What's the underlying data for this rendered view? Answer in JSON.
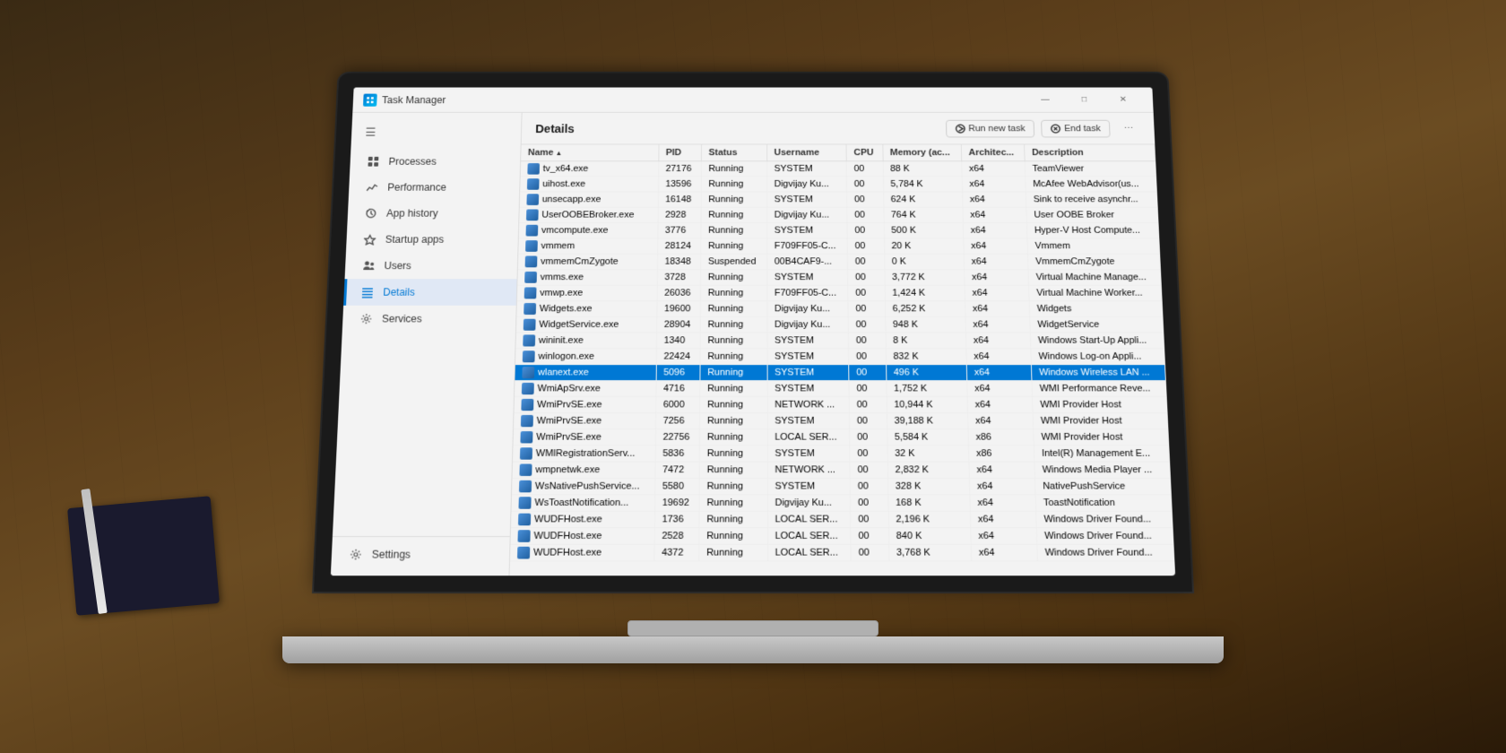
{
  "app": {
    "title": "Task Manager",
    "controls": {
      "minimize": "—",
      "maximize": "□",
      "close": "✕"
    }
  },
  "sidebar": {
    "hamburger": "☰",
    "items": [
      {
        "id": "processes",
        "label": "Processes",
        "icon": "grid"
      },
      {
        "id": "performance",
        "label": "Performance",
        "icon": "chart"
      },
      {
        "id": "app-history",
        "label": "App history",
        "icon": "clock"
      },
      {
        "id": "startup-apps",
        "label": "Startup apps",
        "icon": "rocket"
      },
      {
        "id": "users",
        "label": "Users",
        "icon": "people"
      },
      {
        "id": "details",
        "label": "Details",
        "icon": "list",
        "active": true
      },
      {
        "id": "services",
        "label": "Services",
        "icon": "gear-sm"
      }
    ],
    "settings": {
      "label": "Settings",
      "icon": "gear"
    }
  },
  "content": {
    "title": "Details",
    "actions": {
      "run_new_task": "Run new task",
      "end_task": "End task",
      "more": "⋯"
    }
  },
  "table": {
    "columns": [
      {
        "id": "name",
        "label": "Name",
        "sorted": true
      },
      {
        "id": "pid",
        "label": "PID"
      },
      {
        "id": "status",
        "label": "Status"
      },
      {
        "id": "username",
        "label": "Username"
      },
      {
        "id": "cpu",
        "label": "CPU"
      },
      {
        "id": "memory",
        "label": "Memory (ac..."
      },
      {
        "id": "architecture",
        "label": "Architec..."
      },
      {
        "id": "description",
        "label": "Description"
      }
    ],
    "rows": [
      {
        "name": "tv_x64.exe",
        "pid": "27176",
        "status": "Running",
        "username": "SYSTEM",
        "cpu": "00",
        "memory": "88 K",
        "arch": "x64",
        "desc": "TeamViewer"
      },
      {
        "name": "uihost.exe",
        "pid": "13596",
        "status": "Running",
        "username": "Digvijay Ku...",
        "cpu": "00",
        "memory": "5,784 K",
        "arch": "x64",
        "desc": "McAfee WebAdvisor(us..."
      },
      {
        "name": "unsecapp.exe",
        "pid": "16148",
        "status": "Running",
        "username": "SYSTEM",
        "cpu": "00",
        "memory": "624 K",
        "arch": "x64",
        "desc": "Sink to receive asynchr..."
      },
      {
        "name": "UserOOBEBroker.exe",
        "pid": "2928",
        "status": "Running",
        "username": "Digvijay Ku...",
        "cpu": "00",
        "memory": "764 K",
        "arch": "x64",
        "desc": "User OOBE Broker"
      },
      {
        "name": "vmcompute.exe",
        "pid": "3776",
        "status": "Running",
        "username": "SYSTEM",
        "cpu": "00",
        "memory": "500 K",
        "arch": "x64",
        "desc": "Hyper-V Host Compute..."
      },
      {
        "name": "vmmem",
        "pid": "28124",
        "status": "Running",
        "username": "F709FF05-C...",
        "cpu": "00",
        "memory": "20 K",
        "arch": "x64",
        "desc": "Vmmem"
      },
      {
        "name": "vmmemCmZygote",
        "pid": "18348",
        "status": "Suspended",
        "username": "00B4CAF9-...",
        "cpu": "00",
        "memory": "0 K",
        "arch": "x64",
        "desc": "VmmemCmZygote"
      },
      {
        "name": "vmms.exe",
        "pid": "3728",
        "status": "Running",
        "username": "SYSTEM",
        "cpu": "00",
        "memory": "3,772 K",
        "arch": "x64",
        "desc": "Virtual Machine Manage..."
      },
      {
        "name": "vmwp.exe",
        "pid": "26036",
        "status": "Running",
        "username": "F709FF05-C...",
        "cpu": "00",
        "memory": "1,424 K",
        "arch": "x64",
        "desc": "Virtual Machine Worker..."
      },
      {
        "name": "Widgets.exe",
        "pid": "19600",
        "status": "Running",
        "username": "Digvijay Ku...",
        "cpu": "00",
        "memory": "6,252 K",
        "arch": "x64",
        "desc": "Widgets"
      },
      {
        "name": "WidgetService.exe",
        "pid": "28904",
        "status": "Running",
        "username": "Digvijay Ku...",
        "cpu": "00",
        "memory": "948 K",
        "arch": "x64",
        "desc": "WidgetService"
      },
      {
        "name": "wininit.exe",
        "pid": "1340",
        "status": "Running",
        "username": "SYSTEM",
        "cpu": "00",
        "memory": "8 K",
        "arch": "x64",
        "desc": "Windows Start-Up Appli..."
      },
      {
        "name": "winlogon.exe",
        "pid": "22424",
        "status": "Running",
        "username": "SYSTEM",
        "cpu": "00",
        "memory": "832 K",
        "arch": "x64",
        "desc": "Windows Log-on Appli..."
      },
      {
        "name": "wlanext.exe",
        "pid": "5096",
        "status": "Running",
        "username": "SYSTEM",
        "cpu": "00",
        "memory": "496 K",
        "arch": "x64",
        "desc": "Windows Wireless LAN ...",
        "selected": true
      },
      {
        "name": "WmiApSrv.exe",
        "pid": "4716",
        "status": "Running",
        "username": "SYSTEM",
        "cpu": "00",
        "memory": "1,752 K",
        "arch": "x64",
        "desc": "WMI Performance Reve..."
      },
      {
        "name": "WmiPrvSE.exe",
        "pid": "6000",
        "status": "Running",
        "username": "NETWORK ...",
        "cpu": "00",
        "memory": "10,944 K",
        "arch": "x64",
        "desc": "WMI Provider Host"
      },
      {
        "name": "WmiPrvSE.exe",
        "pid": "7256",
        "status": "Running",
        "username": "SYSTEM",
        "cpu": "00",
        "memory": "39,188 K",
        "arch": "x64",
        "desc": "WMI Provider Host"
      },
      {
        "name": "WmiPrvSE.exe",
        "pid": "22756",
        "status": "Running",
        "username": "LOCAL SER...",
        "cpu": "00",
        "memory": "5,584 K",
        "arch": "x86",
        "desc": "WMI Provider Host"
      },
      {
        "name": "WMIRegistrationServ...",
        "pid": "5836",
        "status": "Running",
        "username": "SYSTEM",
        "cpu": "00",
        "memory": "32 K",
        "arch": "x86",
        "desc": "Intel(R) Management E..."
      },
      {
        "name": "wmpnetwk.exe",
        "pid": "7472",
        "status": "Running",
        "username": "NETWORK ...",
        "cpu": "00",
        "memory": "2,832 K",
        "arch": "x64",
        "desc": "Windows Media Player ..."
      },
      {
        "name": "WsNativePushService...",
        "pid": "5580",
        "status": "Running",
        "username": "SYSTEM",
        "cpu": "00",
        "memory": "328 K",
        "arch": "x64",
        "desc": "NativePushService"
      },
      {
        "name": "WsToastNotification...",
        "pid": "19692",
        "status": "Running",
        "username": "Digvijay Ku...",
        "cpu": "00",
        "memory": "168 K",
        "arch": "x64",
        "desc": "ToastNotification"
      },
      {
        "name": "WUDFHost.exe",
        "pid": "1736",
        "status": "Running",
        "username": "LOCAL SER...",
        "cpu": "00",
        "memory": "2,196 K",
        "arch": "x64",
        "desc": "Windows Driver Found..."
      },
      {
        "name": "WUDFHost.exe",
        "pid": "2528",
        "status": "Running",
        "username": "LOCAL SER...",
        "cpu": "00",
        "memory": "840 K",
        "arch": "x64",
        "desc": "Windows Driver Found..."
      },
      {
        "name": "WUDFHost.exe",
        "pid": "4372",
        "status": "Running",
        "username": "LOCAL SER...",
        "cpu": "00",
        "memory": "3,768 K",
        "arch": "x64",
        "desc": "Windows Driver Found..."
      }
    ]
  }
}
